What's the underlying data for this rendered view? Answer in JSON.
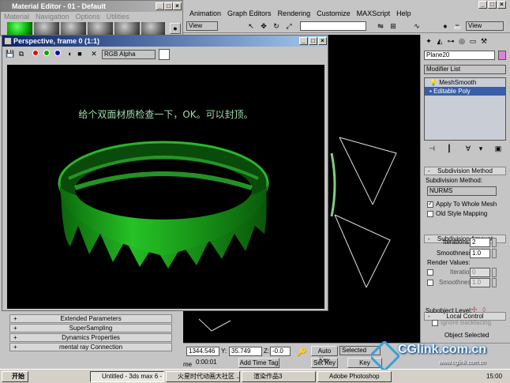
{
  "material_editor": {
    "title": "Material Editor - 01 - Default",
    "menu": [
      "Material",
      "Navigation",
      "Options",
      "Utilities"
    ]
  },
  "main_menu": [
    "Animation",
    "Graph Editors",
    "Rendering",
    "Customize",
    "MAXScript",
    "Help"
  ],
  "toolbar": {
    "view_label": "View",
    "view_label_right": "View"
  },
  "render_window": {
    "title": "Perspective, frame 0 (1:1)",
    "channel": "RGB Alpha",
    "overlay_text": "给个双面材质检查一下，OK。可以封顶。"
  },
  "material_rollouts": [
    "Extended Parameters",
    "SuperSampling",
    "Dynamics Properties",
    "mental ray Connection"
  ],
  "command_panel": {
    "object_name": "Plane20",
    "object_color": "#e080d8",
    "modifier_list": "Modifier List",
    "stack": [
      "MeshSmooth",
      "Editable Poly"
    ],
    "subdivision_method": {
      "header": "Subdivision Method",
      "label": "Subdivision Method:",
      "value": "NURMS",
      "apply_to_whole_mesh": "Apply To Whole Mesh",
      "old_style_mapping": "Old Style Mapping"
    },
    "subdivision_amount": {
      "header": "Subdivision Amount",
      "iterations_label": "Iterations:",
      "iterations": "2",
      "smoothness_label": "Smoothness:",
      "smoothness": "1.0",
      "render_values": "Render Values:",
      "r_iterations_label": "Iterations",
      "r_iterations": "0",
      "r_smoothness_label": "Smoothness",
      "r_smoothness": "1.0"
    },
    "local_control": {
      "header": "Local Control",
      "subobject_label": "Subobject Level:",
      "ignore_backfacing": "Ignore Backfacing",
      "object_selected": "Object Selected"
    }
  },
  "status": {
    "x": "1344.546",
    "y_label": "Y:",
    "y": "35.749",
    "z_label": "Z:",
    "z": "-0.0",
    "time_label": "me",
    "time": "0:00:01",
    "add_time_tag": "Add Time Tag",
    "auto_key": "Auto Key",
    "selected": "Selected",
    "set_key": "Set Key",
    "key_filters": "Key Filters..."
  },
  "taskbar": {
    "start": "开始",
    "tasks": [
      "Untitled - 3ds max 6 - Sta...",
      "火星时代动画大社区 ...",
      "渲染作品3",
      "Adobe Photoshop"
    ],
    "clock": "15:00"
  },
  "watermark": {
    "brand": "CGlink.com.cn",
    "url": "www.cglink.com.cn"
  }
}
